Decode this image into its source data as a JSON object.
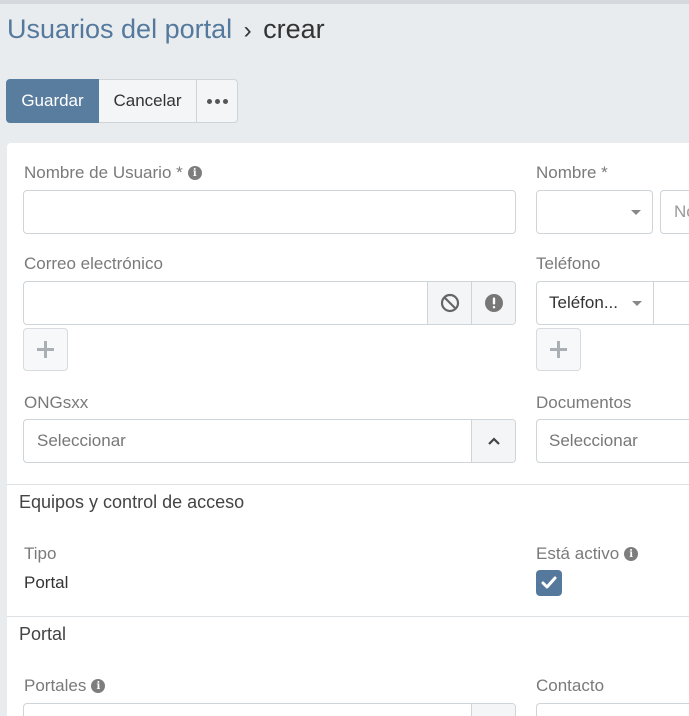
{
  "breadcrumb": {
    "parent": "Usuarios del portal",
    "separator": "›",
    "current": "crear"
  },
  "toolbar": {
    "save_label": "Guardar",
    "cancel_label": "Cancelar"
  },
  "form": {
    "username_label": "Nombre de Usuario *",
    "name_label": "Nombre *",
    "name_partial_placeholder": "Nc",
    "email_label": "Correo electrónico",
    "phone_label": "Teléfono",
    "phone_type_value": "Teléfon...",
    "ongs_label": "ONGsxx",
    "ongs_placeholder": "Seleccionar",
    "documents_label": "Documentos",
    "documents_placeholder": "Seleccionar"
  },
  "teams_section": {
    "title": "Equipos y control de acceso",
    "tipo_label": "Tipo",
    "tipo_value": "Portal",
    "activo_label": "Está activo",
    "activo_checked": true
  },
  "portal_section": {
    "title": "Portal",
    "portales_label": "Portales",
    "contacto_label": "Contacto"
  },
  "colors": {
    "primary": "#587d9e",
    "breadcrumb_link": "#55799d",
    "checkbox": "#55799d"
  }
}
